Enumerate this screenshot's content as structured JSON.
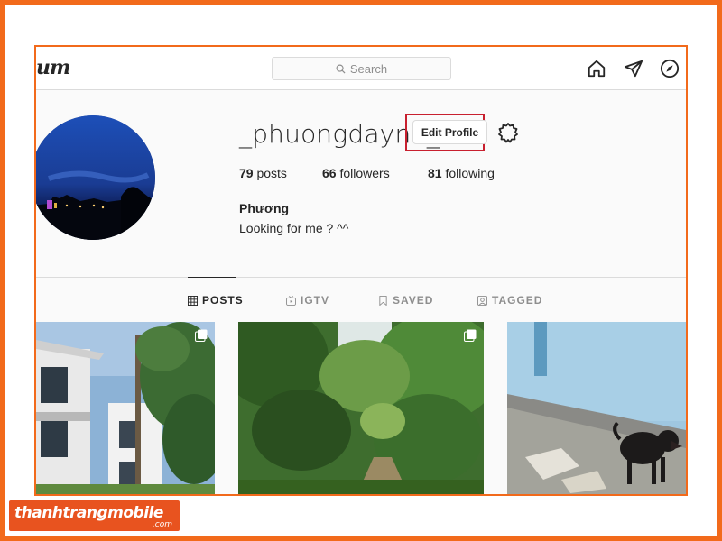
{
  "nav": {
    "logo_fragment": "um",
    "search_placeholder": "Search",
    "icons": [
      "home-icon",
      "direct-message-icon",
      "explore-icon"
    ]
  },
  "profile": {
    "username": "_phuongdayne_",
    "edit_button": "Edit Profile",
    "posts_count": "79",
    "posts_label": "posts",
    "followers_count": "66",
    "followers_label": "followers",
    "following_count": "81",
    "following_label": "following",
    "full_name": "Phương",
    "bio": "Looking for me ? ^^"
  },
  "tabs": [
    {
      "label": "POSTS",
      "icon": "grid-icon",
      "active": true
    },
    {
      "label": "IGTV",
      "icon": "igtv-icon",
      "active": false
    },
    {
      "label": "SAVED",
      "icon": "bookmark-icon",
      "active": false
    },
    {
      "label": "TAGGED",
      "icon": "tagged-icon",
      "active": false
    }
  ],
  "grid": [
    {
      "name": "grid-post-building",
      "multi": true
    },
    {
      "name": "grid-post-forest",
      "multi": true
    },
    {
      "name": "grid-post-dog",
      "multi": false
    }
  ],
  "colors": {
    "frame": "#f26a1b",
    "highlight": "#c8202f",
    "watermark_bg": "#e8531f"
  },
  "watermark": {
    "main": "thanhtrangmobile",
    "sub": ".com"
  }
}
